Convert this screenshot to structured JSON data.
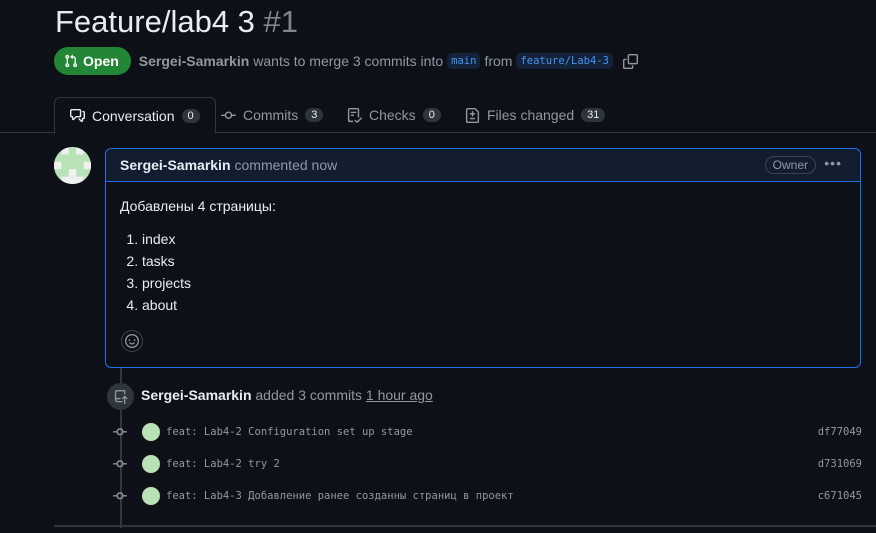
{
  "pr": {
    "title": "Feature/lab4 3",
    "number": "#1",
    "state": "Open",
    "author": "Sergei-Samarkin",
    "merge_text": "wants to merge 3 commits into",
    "base_branch": "main",
    "from_text": "from",
    "head_branch": "feature/Lab4-3"
  },
  "tabs": [
    {
      "label": "Conversation",
      "count": "0",
      "icon": "comment-discussion-icon"
    },
    {
      "label": "Commits",
      "count": "3",
      "icon": "git-commit-icon"
    },
    {
      "label": "Checks",
      "count": "0",
      "icon": "checklist-icon"
    },
    {
      "label": "Files changed",
      "count": "31",
      "icon": "file-diff-icon"
    }
  ],
  "comment": {
    "author": "Sergei-Samarkin",
    "action": "commented now",
    "role_badge": "Owner",
    "body_intro": "Добавлены 4 страницы:",
    "list": [
      "index",
      "tasks",
      "projects",
      "about"
    ]
  },
  "event": {
    "author": "Sergei-Samarkin",
    "action": "added 3 commits",
    "time": "1 hour ago"
  },
  "commits": [
    {
      "message": "feat: Lab4-2 Configuration set up stage",
      "sha": "df77049"
    },
    {
      "message": "feat: Lab4-2 try 2",
      "sha": "d731069"
    },
    {
      "message": "feat: Lab4-3 Добавление ранее созданны страниц в проект",
      "sha": "c671045"
    }
  ],
  "colors": {
    "open": "#238636",
    "accent": "#1f6feb",
    "link": "#4493f8",
    "bg": "#0d1117"
  }
}
